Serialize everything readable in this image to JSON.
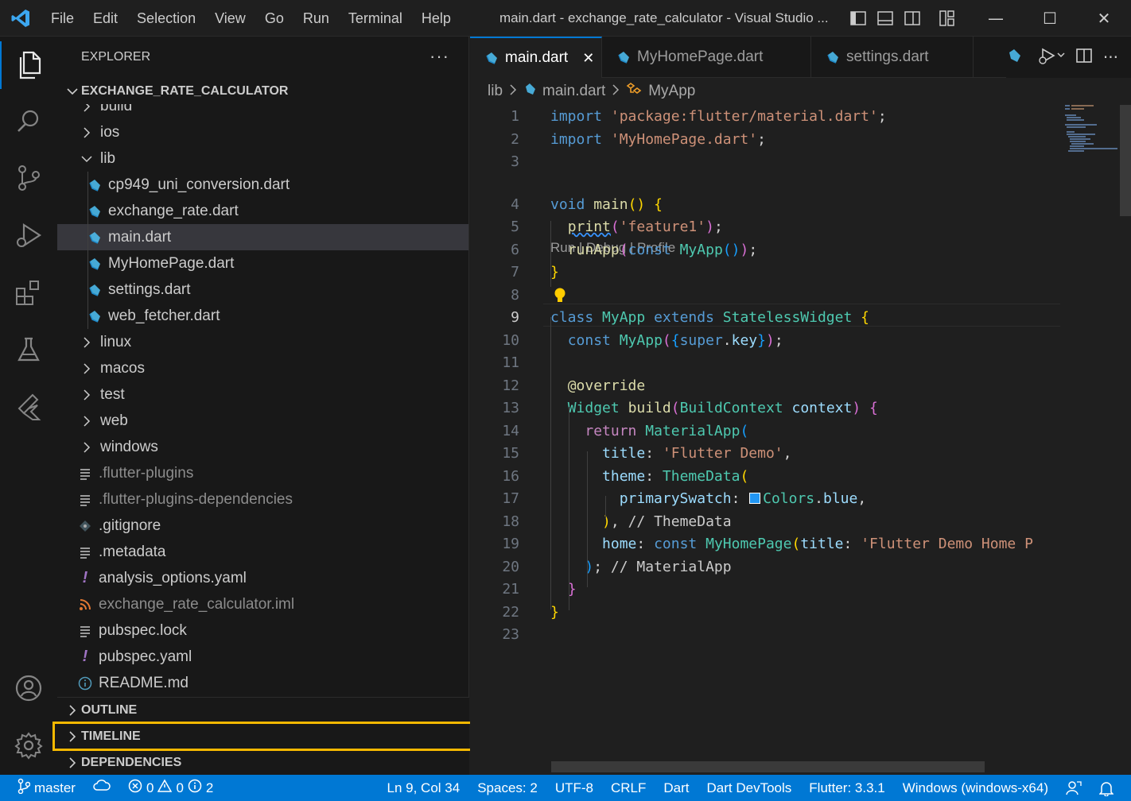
{
  "menu": [
    "File",
    "Edit",
    "Selection",
    "View",
    "Go",
    "Run",
    "Terminal",
    "Help"
  ],
  "window_title": "main.dart - exchange_rate_calculator - Visual Studio ...",
  "sidebar": {
    "header": "EXPLORER",
    "project": "EXCHANGE_RATE_CALCULATOR",
    "tree": [
      {
        "label": "build",
        "type": "folder",
        "depth": 0,
        "dim": false
      },
      {
        "label": "ios",
        "type": "folder",
        "depth": 0,
        "dim": false
      },
      {
        "label": "lib",
        "type": "folder-open",
        "depth": 0,
        "dim": false
      },
      {
        "label": "cp949_uni_conversion.dart",
        "type": "dart",
        "depth": 1,
        "dim": false
      },
      {
        "label": "exchange_rate.dart",
        "type": "dart",
        "depth": 1,
        "dim": false
      },
      {
        "label": "main.dart",
        "type": "dart",
        "depth": 1,
        "dim": false,
        "selected": true
      },
      {
        "label": "MyHomePage.dart",
        "type": "dart",
        "depth": 1,
        "dim": false
      },
      {
        "label": "settings.dart",
        "type": "dart",
        "depth": 1,
        "dim": false
      },
      {
        "label": "web_fetcher.dart",
        "type": "dart",
        "depth": 1,
        "dim": false
      },
      {
        "label": "linux",
        "type": "folder",
        "depth": 0,
        "dim": false
      },
      {
        "label": "macos",
        "type": "folder",
        "depth": 0,
        "dim": false
      },
      {
        "label": "test",
        "type": "folder",
        "depth": 0,
        "dim": false
      },
      {
        "label": "web",
        "type": "folder",
        "depth": 0,
        "dim": false
      },
      {
        "label": "windows",
        "type": "folder",
        "depth": 0,
        "dim": false
      },
      {
        "label": ".flutter-plugins",
        "type": "lines",
        "depth": 0,
        "dim": true
      },
      {
        "label": ".flutter-plugins-dependencies",
        "type": "lines",
        "depth": 0,
        "dim": true
      },
      {
        "label": ".gitignore",
        "type": "git",
        "depth": 0,
        "dim": false
      },
      {
        "label": ".metadata",
        "type": "lines",
        "depth": 0,
        "dim": false
      },
      {
        "label": "analysis_options.yaml",
        "type": "yaml",
        "depth": 0,
        "dim": false
      },
      {
        "label": "exchange_rate_calculator.iml",
        "type": "rss",
        "depth": 0,
        "dim": true
      },
      {
        "label": "pubspec.lock",
        "type": "lines",
        "depth": 0,
        "dim": false
      },
      {
        "label": "pubspec.yaml",
        "type": "yaml",
        "depth": 0,
        "dim": false
      },
      {
        "label": "README.md",
        "type": "info",
        "depth": 0,
        "dim": false
      }
    ],
    "sections": [
      "OUTLINE",
      "TIMELINE",
      "DEPENDENCIES"
    ]
  },
  "tabs": [
    {
      "label": "main.dart",
      "active": true
    },
    {
      "label": "MyHomePage.dart",
      "active": false
    },
    {
      "label": "settings.dart",
      "active": false
    }
  ],
  "breadcrumb": [
    "lib",
    "main.dart",
    "MyApp"
  ],
  "codelens": "Run | Debug | Profile",
  "code": [
    {
      "n": "1",
      "tokens": [
        [
          "kw",
          "import"
        ],
        [
          "plain",
          " "
        ],
        [
          "str",
          "'package:flutter/material.dart'"
        ],
        [
          "plain",
          ";"
        ]
      ]
    },
    {
      "n": "2",
      "tokens": [
        [
          "kw",
          "import"
        ],
        [
          "plain",
          " "
        ],
        [
          "str",
          "'MyHomePage.dart'"
        ],
        [
          "plain",
          ";"
        ]
      ]
    },
    {
      "n": "3",
      "tokens": []
    },
    {
      "n": "4",
      "tokens": [
        [
          "kw",
          "void"
        ],
        [
          "plain",
          " "
        ],
        [
          "fn",
          "main"
        ],
        [
          "br1",
          "()"
        ],
        [
          "plain",
          " "
        ],
        [
          "br1",
          "{"
        ]
      ]
    },
    {
      "n": "5",
      "tokens": [
        [
          "plain",
          "  "
        ],
        [
          "fn",
          "print",
          "squig"
        ],
        [
          "br2",
          "("
        ],
        [
          "str",
          "'feature1'"
        ],
        [
          "br2",
          ")"
        ],
        [
          "plain",
          ";"
        ]
      ]
    },
    {
      "n": "6",
      "tokens": [
        [
          "plain",
          "  "
        ],
        [
          "fn",
          "runApp"
        ],
        [
          "br2",
          "("
        ],
        [
          "kw",
          "const"
        ],
        [
          "plain",
          " "
        ],
        [
          "cls",
          "MyApp"
        ],
        [
          "br3",
          "()"
        ],
        [
          "br2",
          ")"
        ],
        [
          "plain",
          ";"
        ]
      ]
    },
    {
      "n": "7",
      "tokens": [
        [
          "br1",
          "}"
        ]
      ]
    },
    {
      "n": "8",
      "tokens": []
    },
    {
      "n": "9",
      "tokens": [
        [
          "kw",
          "class"
        ],
        [
          "plain",
          " "
        ],
        [
          "cls",
          "MyApp"
        ],
        [
          "plain",
          " "
        ],
        [
          "kw",
          "extends"
        ],
        [
          "plain",
          " "
        ],
        [
          "cls",
          "StatelessWidget"
        ],
        [
          "plain",
          " "
        ],
        [
          "br1",
          "{"
        ]
      ]
    },
    {
      "n": "10",
      "tokens": [
        [
          "plain",
          "  "
        ],
        [
          "kw",
          "const"
        ],
        [
          "plain",
          " "
        ],
        [
          "cls",
          "MyApp"
        ],
        [
          "br2",
          "("
        ],
        [
          "br3",
          "{"
        ],
        [
          "kw",
          "super"
        ],
        [
          "plain",
          "."
        ],
        [
          "var",
          "key"
        ],
        [
          "br3",
          "}"
        ],
        [
          "br2",
          ")"
        ],
        [
          "plain",
          ";"
        ]
      ]
    },
    {
      "n": "11",
      "tokens": []
    },
    {
      "n": "12",
      "tokens": [
        [
          "plain",
          "  "
        ],
        [
          "fn",
          "@override"
        ]
      ]
    },
    {
      "n": "13",
      "tokens": [
        [
          "plain",
          "  "
        ],
        [
          "cls",
          "Widget"
        ],
        [
          "plain",
          " "
        ],
        [
          "fn",
          "build"
        ],
        [
          "br2",
          "("
        ],
        [
          "cls",
          "BuildContext"
        ],
        [
          "plain",
          " "
        ],
        [
          "var",
          "context"
        ],
        [
          "br2",
          ")"
        ],
        [
          "plain",
          " "
        ],
        [
          "br2",
          "{"
        ]
      ]
    },
    {
      "n": "14",
      "tokens": [
        [
          "plain",
          "    "
        ],
        [
          "ctl",
          "return"
        ],
        [
          "plain",
          " "
        ],
        [
          "cls",
          "MaterialApp"
        ],
        [
          "br3",
          "("
        ]
      ]
    },
    {
      "n": "15",
      "tokens": [
        [
          "plain",
          "      "
        ],
        [
          "var",
          "title"
        ],
        [
          "plain",
          ": "
        ],
        [
          "str",
          "'Flutter Demo'"
        ],
        [
          "plain",
          ","
        ]
      ]
    },
    {
      "n": "16",
      "tokens": [
        [
          "plain",
          "      "
        ],
        [
          "var",
          "theme"
        ],
        [
          "plain",
          ": "
        ],
        [
          "cls",
          "ThemeData"
        ],
        [
          "br1",
          "("
        ]
      ]
    },
    {
      "n": "17",
      "tokens": [
        [
          "plain",
          "        "
        ],
        [
          "var",
          "primarySwatch"
        ],
        [
          "plain",
          ":  "
        ],
        [
          "cls",
          "Colors"
        ],
        [
          "plain",
          "."
        ],
        [
          "var",
          "blue"
        ],
        [
          "plain",
          ","
        ]
      ]
    },
    {
      "n": "18",
      "tokens": [
        [
          "plain",
          "      "
        ],
        [
          "br1",
          ")"
        ],
        [
          "plain",
          ", "
        ],
        [
          "cmt",
          "// ThemeData"
        ]
      ]
    },
    {
      "n": "19",
      "tokens": [
        [
          "plain",
          "      "
        ],
        [
          "var",
          "home"
        ],
        [
          "plain",
          ": "
        ],
        [
          "kw",
          "const"
        ],
        [
          "plain",
          " "
        ],
        [
          "cls",
          "MyHomePage"
        ],
        [
          "br1",
          "("
        ],
        [
          "var",
          "title"
        ],
        [
          "plain",
          ": "
        ],
        [
          "str",
          "'Flutter Demo Home P"
        ]
      ]
    },
    {
      "n": "20",
      "tokens": [
        [
          "plain",
          "    "
        ],
        [
          "br3",
          ")"
        ],
        [
          "plain",
          "; "
        ],
        [
          "cmt",
          "// MaterialApp"
        ]
      ]
    },
    {
      "n": "21",
      "tokens": [
        [
          "plain",
          "  "
        ],
        [
          "br2",
          "}"
        ]
      ]
    },
    {
      "n": "22",
      "tokens": [
        [
          "br1",
          "}"
        ]
      ]
    },
    {
      "n": "23",
      "tokens": []
    }
  ],
  "status": {
    "branch": "master",
    "errors": "0",
    "warnings": "0",
    "infos": "2",
    "position": "Ln 9, Col 34",
    "spaces": "Spaces: 2",
    "encoding": "UTF-8",
    "eol": "CRLF",
    "language": "Dart",
    "devtools": "Dart DevTools",
    "flutter": "Flutter: 3.3.1",
    "device": "Windows (windows-x64)"
  },
  "colors": {
    "accent": "#0078d4",
    "highlight": "#f5b800",
    "swatch": "#2196f3"
  }
}
